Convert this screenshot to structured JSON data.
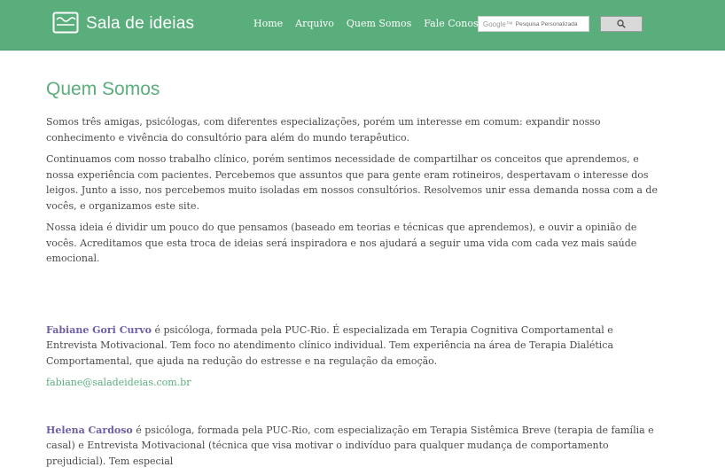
{
  "header": {
    "logo_text": "Sala de ideias",
    "nav": [
      "Home",
      "Arquivo",
      "Quem Somos",
      "Fale Conosco"
    ],
    "search": {
      "brand": "Google™",
      "placeholder": "Pesquisa Personalizada",
      "button_icon": "search-icon"
    },
    "colors": {
      "header_bg": "#5aae7c",
      "accent": "#5aae7c",
      "name_color": "#6f5ea6"
    }
  },
  "main": {
    "title": "Quem Somos",
    "paragraphs": [
      "Somos três amigas, psicólogas, com diferentes especializações, porém um interesse em comum: expandir nosso conhecimento e vivência do consultório para além do mundo terapêutico.",
      "Continuamos com nosso trabalho clínico, porém sentimos necessidade de compartilhar os conceitos que aprendemos, e nossa experiência com pacientes. Percebemos que assuntos que para gente eram rotineiros, despertavam o interesse dos leigos. Junto a isso, nos percebemos muito isoladas em nossos consultórios. Resolvemos unir essa demanda nossa com a de vocês, e organizamos este site.",
      "Nossa ideia é dividir um pouco do que pensamos (baseado em teorias e técnicas que aprendemos), e ouvir a opinião de vocês. Acreditamos que esta troca de ideias será inspiradora e nos ajudará a seguir uma vida com cada vez mais saúde emocional."
    ],
    "people": [
      {
        "name": "Fabiane Gori Curvo",
        "bio": " é psicóloga, formada pela PUC-Rio. É especializada em Terapia Cognitiva Comportamental e Entrevista Motivacional. Tem foco no atendimento clínico individual. Tem experiência na área de Terapia Dialética Comportamental, que ajuda na redução do estresse e na regulação da emoção.",
        "email": "fabiane@saladeideias.com.br"
      },
      {
        "name": "Helena Cardoso",
        "bio": " é psicóloga, formada pela PUC-Rio, com especialização em Terapia Sistêmica Breve (terapia de família e casal) e Entrevista Motivacional (técnica que visa motivar o indivíduo para qualquer mudança de comportamento prejudicial). Tem especial"
      }
    ]
  }
}
